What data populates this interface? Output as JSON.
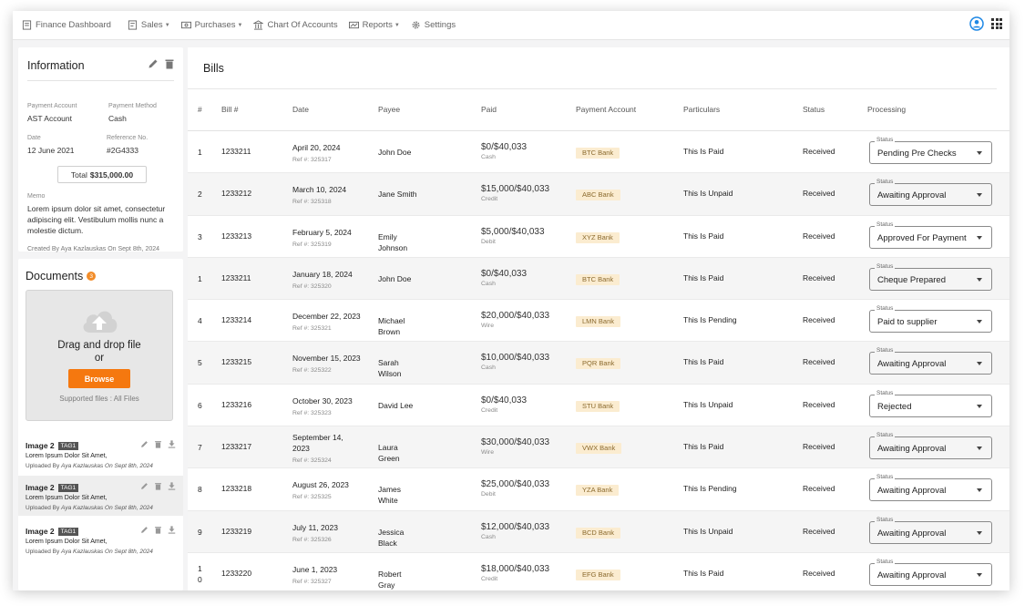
{
  "nav": {
    "items": [
      {
        "label": "Finance Dashboard",
        "icon": "dashboard-icon",
        "caret": false
      },
      {
        "label": "Sales",
        "icon": "sales-icon",
        "caret": true
      },
      {
        "label": "Purchases",
        "icon": "purchases-icon",
        "caret": true
      },
      {
        "label": "Chart Of Accounts",
        "icon": "bank-icon",
        "caret": false
      },
      {
        "label": "Reports",
        "icon": "reports-icon",
        "caret": true
      },
      {
        "label": "Settings",
        "icon": "gear-icon",
        "caret": false
      }
    ],
    "caret_glyph": "▼"
  },
  "info": {
    "title": "Information",
    "payment_account_label": "Payment Account",
    "payment_account": "AST Account",
    "payment_method_label": "Payment Method",
    "payment_method": "Cash",
    "date_label": "Date",
    "date": "12 June 2021",
    "reference_label": "Reference No.",
    "reference": "#2G4333",
    "total_label": "Total",
    "total_value": "$315,000.00",
    "memo_label": "Memo",
    "memo": "Lorem ipsum dolor sit amet, consectetur adipiscing elit. Vestibulum mollis nunc a molestie dictum.",
    "created": "Created By Aya Kazlauskas On Sept 8th, 2024"
  },
  "documents": {
    "title": "Documents",
    "count": "3",
    "drop_line1": "Drag and drop file",
    "drop_line2": "or",
    "browse_label": "Browse",
    "supported": "Supported files : All Files",
    "items": [
      {
        "name": "Image 2",
        "tag": "TAG1",
        "desc": "Lorem Ipsum Dolor Sit Amet,",
        "uploaded_prefix": "Uploaded By",
        "uploaded_info": "Aya Kazlauskas On Sept 8th, 2024"
      },
      {
        "name": "Image 2",
        "tag": "TAG1",
        "desc": "Lorem Ipsum Dolor Sit Amet,",
        "uploaded_prefix": "Uploaded By",
        "uploaded_info": "Aya Kazlauskas On Sept 8th, 2024"
      },
      {
        "name": "Image 2",
        "tag": "TAG1",
        "desc": "Lorem Ipsum Dolor Sit Amet,",
        "uploaded_prefix": "Uploaded By",
        "uploaded_info": "Aya Kazlauskas On Sept 8th, 2024"
      }
    ]
  },
  "bills": {
    "title": "Bills",
    "columns": [
      "#",
      "Bill #",
      "Date",
      "Payee",
      "Paid",
      "Payment Account",
      "Particulars",
      "Status",
      "Processing"
    ],
    "status_field_label": "Status",
    "rows": [
      {
        "num": "1",
        "bill": "1233211",
        "date": "April 20, 2024",
        "ref": "Ref #: 325317",
        "payee": "John Doe",
        "paid": "$0/$40,033",
        "method": "Cash",
        "account": "BTC Bank",
        "particulars": "This Is Paid",
        "status": "Received",
        "processing": "Pending Pre Checks"
      },
      {
        "num": "2",
        "bill": "1233212",
        "date": "March 10, 2024",
        "ref": "Ref #: 325318",
        "payee": "Jane Smith",
        "paid": "$15,000/$40,033",
        "method": "Credit",
        "account": "ABC Bank",
        "particulars": "This Is Unpaid",
        "status": "Received",
        "processing": "Awaiting Approval"
      },
      {
        "num": "3",
        "bill": "1233213",
        "date": "February 5, 2024",
        "ref": "Ref #: 325319",
        "payee": "Emily Johnson",
        "paid": "$5,000/$40,033",
        "method": "Debit",
        "account": "XYZ Bank",
        "particulars": "This Is Paid",
        "status": "Received",
        "processing": "Approved For Payment"
      },
      {
        "num": "1",
        "bill": "1233211",
        "date": "January 18, 2024",
        "ref": "Ref #: 325320",
        "payee": "John Doe",
        "paid": "$0/$40,033",
        "method": "Cash",
        "account": "BTC Bank",
        "particulars": "This Is Paid",
        "status": "Received",
        "processing": "Cheque Prepared"
      },
      {
        "num": "4",
        "bill": "1233214",
        "date": "December 22, 2023",
        "ref": "Ref #: 325321",
        "payee": "Michael Brown",
        "paid": "$20,000/$40,033",
        "method": "Wire",
        "account": "LMN Bank",
        "particulars": "This Is Pending",
        "status": "Received",
        "processing": "Paid to supplier"
      },
      {
        "num": "5",
        "bill": "1233215",
        "date": "November 15, 2023",
        "ref": "Ref #: 325322",
        "payee": "Sarah Wilson",
        "paid": "$10,000/$40,033",
        "method": "Cash",
        "account": "PQR Bank",
        "particulars": "This Is Paid",
        "status": "Received",
        "processing": "Awaiting Approval"
      },
      {
        "num": "6",
        "bill": "1233216",
        "date": "October 30, 2023",
        "ref": "Ref #: 325323",
        "payee": "David Lee",
        "paid": "$0/$40,033",
        "method": "Credit",
        "account": "STU Bank",
        "particulars": "This Is Unpaid",
        "status": "Received",
        "processing": "Rejected"
      },
      {
        "num": "7",
        "bill": "1233217",
        "date": "September 14, 2023",
        "ref": "Ref #: 325324",
        "payee": "Laura Green",
        "paid": "$30,000/$40,033",
        "method": "Wire",
        "account": "VWX Bank",
        "particulars": "This Is Paid",
        "status": "Received",
        "processing": "Awaiting Approval"
      },
      {
        "num": "8",
        "bill": "1233218",
        "date": "August 26, 2023",
        "ref": "Ref #: 325325",
        "payee": "James White",
        "paid": "$25,000/$40,033",
        "method": "Debit",
        "account": "YZA Bank",
        "particulars": "This Is Pending",
        "status": "Received",
        "processing": "Awaiting Approval"
      },
      {
        "num": "9",
        "bill": "1233219",
        "date": "July 11, 2023",
        "ref": "Ref #: 325326",
        "payee": "Jessica Black",
        "paid": "$12,000/$40,033",
        "method": "Cash",
        "account": "BCD Bank",
        "particulars": "This Is Unpaid",
        "status": "Received",
        "processing": "Awaiting Approval"
      },
      {
        "num": "10",
        "bill": "1233220",
        "date": "June 1, 2023",
        "ref": "Ref #: 325327",
        "payee": "Robert Gray",
        "paid": "$18,000/$40,033",
        "method": "Credit",
        "account": "EFG Bank",
        "particulars": "This Is Paid",
        "status": "Received",
        "processing": "Awaiting Approval"
      }
    ]
  },
  "colors": {
    "accent": "#f5780f",
    "user_icon": "#1e88e5",
    "bank_badge_bg": "#fbecd0"
  }
}
